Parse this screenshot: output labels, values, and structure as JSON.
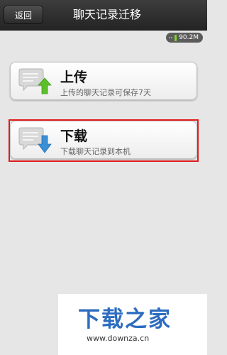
{
  "titlebar": {
    "back_label": "返回",
    "title": "聊天记录迁移"
  },
  "storage": {
    "value": "90.2M",
    "indicator_color": "#7cd42a"
  },
  "options": {
    "upload": {
      "title": "上传",
      "subtitle": "上传的聊天记录可保存7天",
      "icon": "chat-upload-icon",
      "arrow_color": "#5bbf2a"
    },
    "download": {
      "title": "下载",
      "subtitle": "下载聊天记录到本机",
      "icon": "chat-download-icon",
      "arrow_color": "#3a8fd6"
    }
  },
  "highlight": {
    "target": "download",
    "color": "#e11b1b"
  },
  "watermark": {
    "brand": "下载之家",
    "url": "www.downza.cn"
  }
}
